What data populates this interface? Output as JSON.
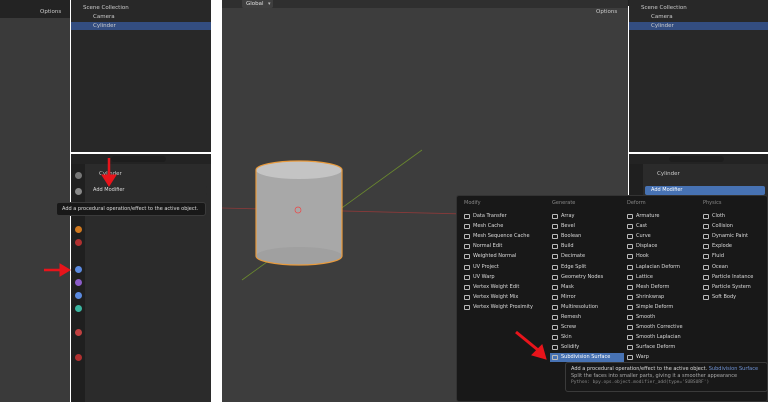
{
  "left": {
    "options_label": "Options",
    "outliner": [
      "Scene Collection",
      "Camera",
      "Cylinder"
    ],
    "object_name": "Cylinder",
    "add_modifier": "Add Modifier",
    "tooltip": "Add a procedural operation/effect to the active object."
  },
  "right": {
    "viewport_orientation": "Global",
    "options_label": "Options",
    "outliner": [
      "Scene Collection",
      "Camera",
      "Cylinder"
    ],
    "object_name": "Cylinder",
    "add_modifier": "Add Modifier",
    "menu": {
      "columns": [
        {
          "title": "Modify",
          "items": [
            "Data Transfer",
            "Mesh Cache",
            "Mesh Sequence Cache",
            "Normal Edit",
            "Weighted Normal",
            "UV Project",
            "UV Warp",
            "Vertex Weight Edit",
            "Vertex Weight Mix",
            "Vertex Weight Proximity"
          ]
        },
        {
          "title": "Generate",
          "items": [
            "Array",
            "Bevel",
            "Boolean",
            "Build",
            "Decimate",
            "Edge Split",
            "Geometry Nodes",
            "Mask",
            "Mirror",
            "Multiresolution",
            "Remesh",
            "Screw",
            "Skin",
            "Solidify",
            "Subdivision Surface"
          ]
        },
        {
          "title": "Deform",
          "items": [
            "Armature",
            "Cast",
            "Curve",
            "Displace",
            "Hook",
            "Laplacian Deform",
            "Lattice",
            "Mesh Deform",
            "Shrinkwrap",
            "Simple Deform",
            "Smooth",
            "Smooth Corrective",
            "Smooth Laplacian",
            "Surface Deform",
            "Warp"
          ]
        },
        {
          "title": "Physics",
          "items": [
            "Cloth",
            "Collision",
            "Dynamic Paint",
            "Explode",
            "Fluid",
            "Ocean",
            "Particle Instance",
            "Particle System",
            "Soft Body"
          ]
        }
      ],
      "highlighted": "Subdivision Surface"
    },
    "tooltip": {
      "line1": "Add a procedural operation/effect to the active object.",
      "name": "Subdivision Surface",
      "line2": "Split the faces into smaller parts, giving it a smoother appearance",
      "line3": "Python: bpy.ops.object.modifier_add(type='SUBSURF')"
    }
  },
  "colors": {
    "accent": "#4772b3",
    "arrow": "#e8141b",
    "cylinder_outline": "#e89a3c"
  }
}
